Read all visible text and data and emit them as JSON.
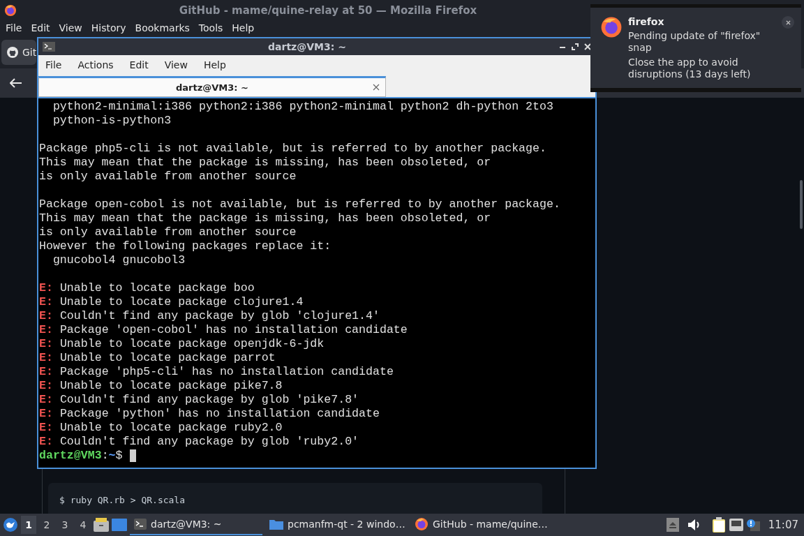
{
  "browser": {
    "title": "GitHub - mame/quine-relay at 50 — Mozilla Firefox",
    "menu": [
      "File",
      "Edit",
      "View",
      "History",
      "Bookmarks",
      "Tools",
      "Help"
    ],
    "tab_label": "Git",
    "code_line": "$ ruby QR.rb > QR.scala"
  },
  "terminal": {
    "title": "dartz@VM3: ~",
    "menu": [
      "File",
      "Actions",
      "Edit",
      "View",
      "Help"
    ],
    "tabs": [
      {
        "label": "dartz@VM3: ~",
        "selected": true
      }
    ],
    "lines": [
      {
        "kind": "plain",
        "text": "  python2-minimal:i386 python2:i386 python2-minimal python2 dh-python 2to3"
      },
      {
        "kind": "plain",
        "text": "  python-is-python3"
      },
      {
        "kind": "blank"
      },
      {
        "kind": "plain",
        "text": "Package php5-cli is not available, but is referred to by another package."
      },
      {
        "kind": "plain",
        "text": "This may mean that the package is missing, has been obsoleted, or"
      },
      {
        "kind": "plain",
        "text": "is only available from another source"
      },
      {
        "kind": "blank"
      },
      {
        "kind": "plain",
        "text": "Package open-cobol is not available, but is referred to by another package."
      },
      {
        "kind": "plain",
        "text": "This may mean that the package is missing, has been obsoleted, or"
      },
      {
        "kind": "plain",
        "text": "is only available from another source"
      },
      {
        "kind": "plain",
        "text": "However the following packages replace it:"
      },
      {
        "kind": "plain",
        "text": "  gnucobol4 gnucobol3"
      },
      {
        "kind": "blank"
      },
      {
        "kind": "error",
        "marker": "E:",
        "text": " Unable to locate package boo"
      },
      {
        "kind": "error",
        "marker": "E:",
        "text": " Unable to locate package clojure1.4"
      },
      {
        "kind": "error",
        "marker": "E:",
        "text": " Couldn't find any package by glob 'clojure1.4'"
      },
      {
        "kind": "error",
        "marker": "E:",
        "text": " Package 'open-cobol' has no installation candidate"
      },
      {
        "kind": "error",
        "marker": "E:",
        "text": " Unable to locate package openjdk-6-jdk"
      },
      {
        "kind": "error",
        "marker": "E:",
        "text": " Unable to locate package parrot"
      },
      {
        "kind": "error",
        "marker": "E:",
        "text": " Package 'php5-cli' has no installation candidate"
      },
      {
        "kind": "error",
        "marker": "E:",
        "text": " Unable to locate package pike7.8"
      },
      {
        "kind": "error",
        "marker": "E:",
        "text": " Couldn't find any package by glob 'pike7.8'"
      },
      {
        "kind": "error",
        "marker": "E:",
        "text": " Package 'python' has no installation candidate"
      },
      {
        "kind": "error",
        "marker": "E:",
        "text": " Unable to locate package ruby2.0"
      },
      {
        "kind": "error",
        "marker": "E:",
        "text": " Couldn't find any package by glob 'ruby2.0'"
      }
    ],
    "prompt": {
      "user": "dartz@VM3",
      "sep": ":",
      "path": "~",
      "symbol": "$"
    }
  },
  "notification": {
    "app": "firefox",
    "message": "Pending update of \"firefox\" snap",
    "detail": "Close the app to avoid disruptions (13 days left)"
  },
  "taskbar": {
    "workspaces": [
      {
        "label": "1",
        "selected": true
      },
      {
        "label": "2",
        "selected": false
      },
      {
        "label": "3",
        "selected": false
      },
      {
        "label": "4",
        "selected": false
      }
    ],
    "tasks": [
      {
        "kind": "terminal",
        "label": "dartz@VM3: ~",
        "selected": true
      },
      {
        "kind": "folder",
        "label": "pcmanfm-qt - 2 windo…",
        "selected": false
      },
      {
        "kind": "browser",
        "label": "GitHub - mame/quine…",
        "selected": false
      }
    ],
    "clock": "11:07"
  }
}
